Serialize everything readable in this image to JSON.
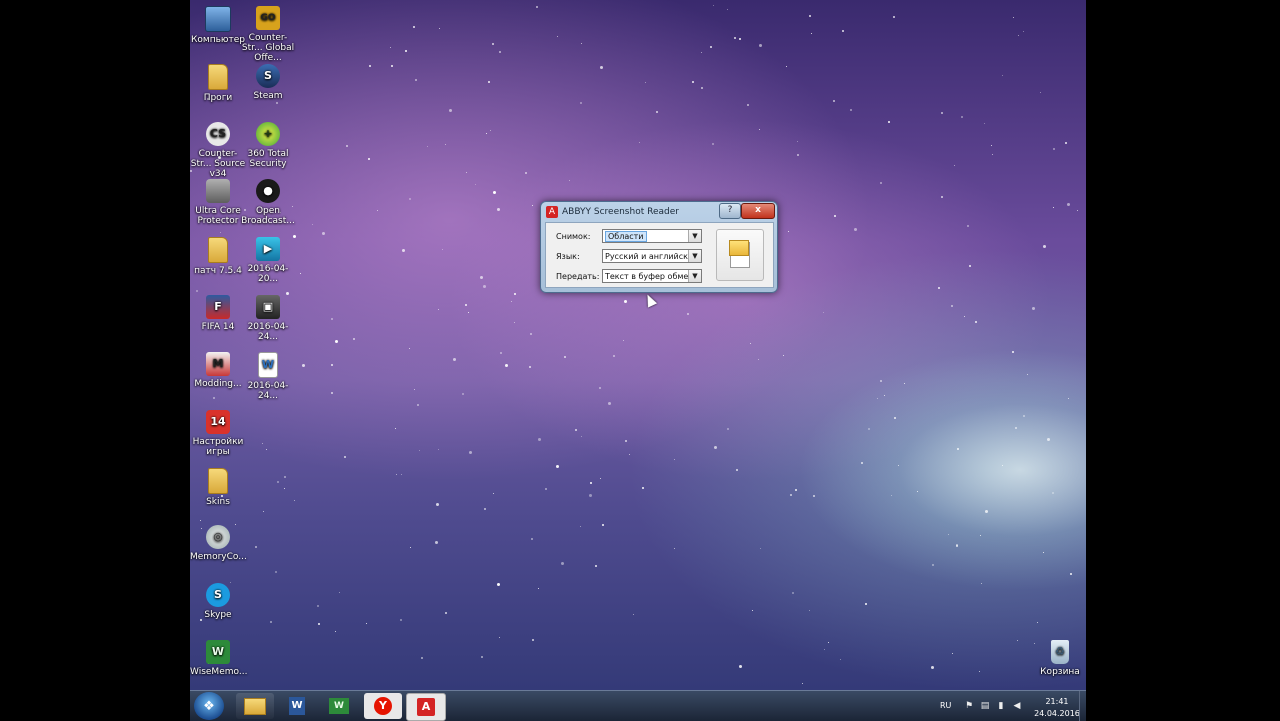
{
  "desktop_icons": [
    {
      "id": "computer",
      "label": "Компьютер",
      "icon": "monitor-icon",
      "glyph": ""
    },
    {
      "id": "csgo",
      "label": "Counter-Str... Global Offe...",
      "icon": "csgo-icon",
      "glyph": "GO"
    },
    {
      "id": "progi",
      "label": "Проги",
      "icon": "folder-icon",
      "glyph": ""
    },
    {
      "id": "steam",
      "label": "Steam",
      "icon": "steam-icon",
      "glyph": "S"
    },
    {
      "id": "cs-source",
      "label": "Counter-Str... Source v34",
      "icon": "cs-source-icon",
      "glyph": "CS"
    },
    {
      "id": "total-security",
      "label": "360 Total Security",
      "icon": "shield-360-icon",
      "glyph": "+"
    },
    {
      "id": "ultra-core",
      "label": "Ultra Core Protector",
      "icon": "gear-icon",
      "glyph": ""
    },
    {
      "id": "obs",
      "label": "Open Broadcast...",
      "icon": "obs-icon",
      "glyph": "●"
    },
    {
      "id": "patch",
      "label": "патч 7.5.4",
      "icon": "folder-icon",
      "glyph": ""
    },
    {
      "id": "video1",
      "label": "2016-04-20...",
      "icon": "video-file-icon",
      "glyph": "▶"
    },
    {
      "id": "fifa",
      "label": "FIFA 14",
      "icon": "fifa-icon",
      "glyph": "F"
    },
    {
      "id": "video2",
      "label": "2016-04-24...",
      "icon": "disk-file-icon",
      "glyph": "▣"
    },
    {
      "id": "modding",
      "label": "Modding...",
      "icon": "modding-icon",
      "glyph": "M"
    },
    {
      "id": "doc",
      "label": "2016-04-24...",
      "icon": "document-icon",
      "glyph": "W"
    },
    {
      "id": "settings",
      "label": "Настройки игры",
      "icon": "game-settings-icon",
      "glyph": "14"
    },
    {
      "id": "skins",
      "label": "Skins",
      "icon": "folder-icon",
      "glyph": ""
    },
    {
      "id": "memory",
      "label": "MemoryCo...",
      "icon": "memory-cleaner-icon",
      "glyph": "◎"
    },
    {
      "id": "skype",
      "label": "Skype",
      "icon": "skype-icon",
      "glyph": "S"
    },
    {
      "id": "wisememo",
      "label": "WiseMemo...",
      "icon": "wise-memory-icon",
      "glyph": "W"
    },
    {
      "id": "trash",
      "label": "Корзина",
      "icon": "recycle-bin-icon",
      "glyph": "♻"
    }
  ],
  "abbyy": {
    "title": "ABBYY Screenshot Reader",
    "help_label": "?",
    "close_label": "x",
    "snapshot_label": "Снимок:",
    "snapshot_value": "Области",
    "language_label": "Язык:",
    "language_value": "Русский и английский",
    "send_label": "Передать:",
    "send_value": "Текст в буфер обмена"
  },
  "taskbar": {
    "lang": "RU",
    "time": "21:41",
    "date": "24.04.2016",
    "word_glyph": "W",
    "yandex_glyph": "Y",
    "abbyy_glyph": "A",
    "start_glyph": "❖"
  },
  "colors": {
    "accent": "#d42424",
    "taskbar": "#1b2536"
  }
}
